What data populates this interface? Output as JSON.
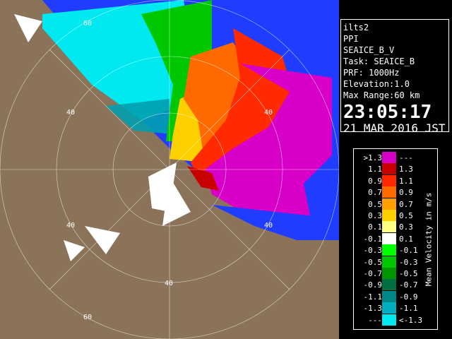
{
  "info": {
    "site": "ilts2",
    "mode": "PPI",
    "product": "SEAICE_B_V",
    "task": "Task: SEAICE_B",
    "prf": "PRF: 1000Hz",
    "elevation": "Elevation:1.0",
    "max_range": "Max Range:60 km",
    "time": "23:05:17",
    "date": "21 MAR 2016 JST"
  },
  "range_labels": [
    "60",
    "40",
    "40",
    "40",
    "40",
    "40",
    "60"
  ],
  "legend": {
    "title": "Mean Velocity in m/s",
    "rows": [
      {
        "left": ">1.3",
        "right": "---",
        "color": "#d800c8"
      },
      {
        "left": "1.1",
        "right": "1.3",
        "color": "#c80000"
      },
      {
        "left": "0.9",
        "right": "1.1",
        "color": "#ff2a00"
      },
      {
        "left": "0.7",
        "right": "0.9",
        "color": "#ff6a00"
      },
      {
        "left": "0.5",
        "right": "0.7",
        "color": "#ffa000"
      },
      {
        "left": "0.3",
        "right": "0.5",
        "color": "#ffd000"
      },
      {
        "left": "0.1",
        "right": "0.3",
        "color": "#ffff80"
      },
      {
        "left": "-0.1",
        "right": "0.1",
        "color": "#ffffff"
      },
      {
        "left": "-0.3",
        "right": "-0.1",
        "color": "#00ff00"
      },
      {
        "left": "-0.5",
        "right": "-0.3",
        "color": "#00c800"
      },
      {
        "left": "-0.7",
        "right": "-0.5",
        "color": "#009600"
      },
      {
        "left": "-0.9",
        "right": "-0.7",
        "color": "#007040"
      },
      {
        "left": "-1.1",
        "right": "-0.9",
        "color": "#008888"
      },
      {
        "left": "-1.3",
        "right": "-1.1",
        "color": "#00b0c0"
      },
      {
        "left": "---",
        "right": "<-1.3",
        "color": "#00e8f0"
      }
    ]
  },
  "colors": {
    "land": "#8a7358",
    "sea_background": "#0044ff",
    "ring": "#ffffff"
  }
}
